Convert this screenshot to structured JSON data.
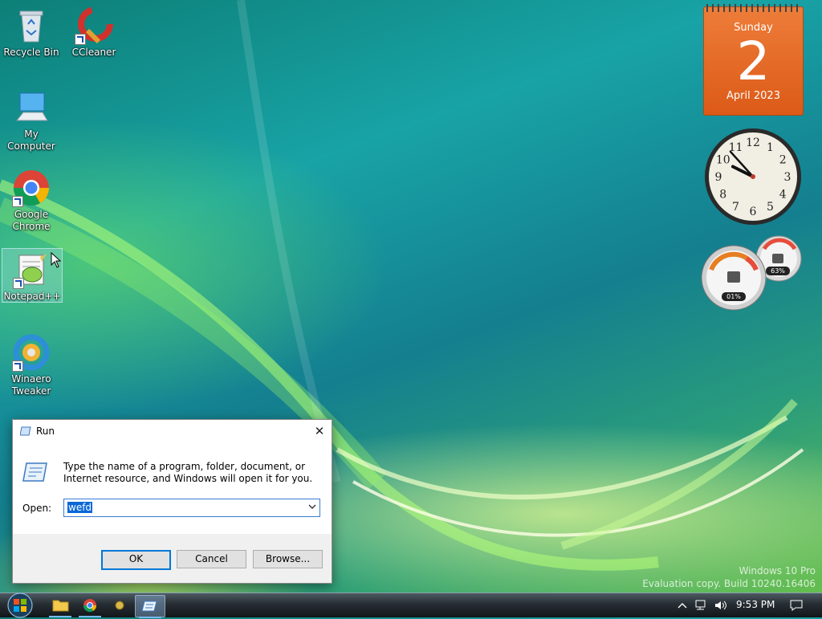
{
  "desktop": {
    "icons": [
      {
        "label": "Recycle Bin"
      },
      {
        "label": "CCleaner"
      },
      {
        "label": "My Computer"
      },
      {
        "label": "Google Chrome"
      },
      {
        "label": "Notepad++"
      },
      {
        "label": "Winaero Tweaker"
      }
    ],
    "watermark_line1": "Windows 10 Pro",
    "watermark_line2": "Evaluation copy. Build 10240.16406"
  },
  "gadgets": {
    "calendar": {
      "weekday": "Sunday",
      "day": "2",
      "month_year": "April 2023"
    },
    "clock": {
      "hour": 9,
      "minute": 53
    },
    "cpu_meter": {
      "cpu": "01%",
      "memory": "63%"
    }
  },
  "run_dialog": {
    "title": "Run",
    "description": "Type the name of a program, folder, document, or Internet resource, and Windows will open it for you.",
    "open_label": "Open:",
    "open_value": "wefd",
    "ok_label": "OK",
    "cancel_label": "Cancel",
    "browse_label": "Browse...",
    "close_glyph": "✕"
  },
  "taskbar": {
    "time": "9:53 PM",
    "pinned": [
      "file-explorer",
      "google-chrome",
      "app",
      "run"
    ]
  }
}
